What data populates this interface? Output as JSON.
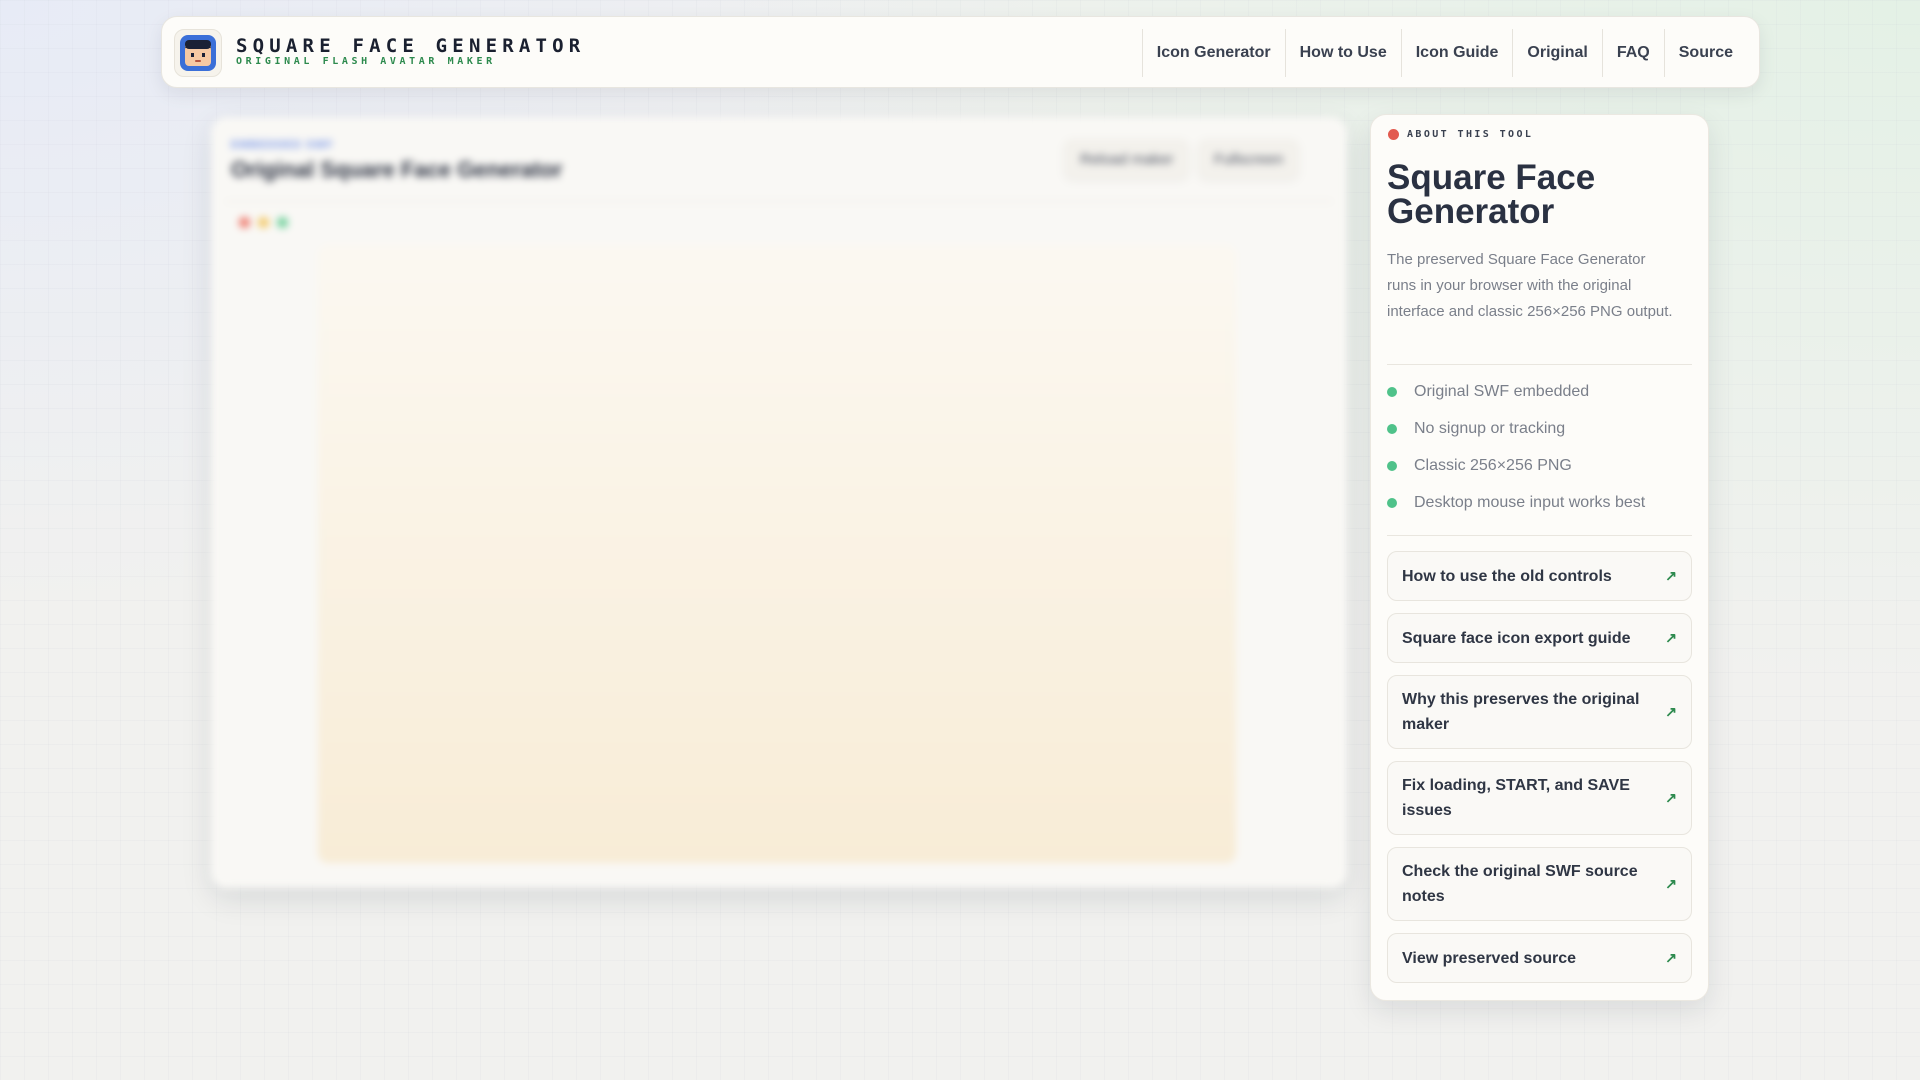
{
  "header": {
    "title": "SQUARE FACE GENERATOR",
    "subtitle": "ORIGINAL FLASH AVATAR MAKER",
    "logo_icon": "square-face-avatar-icon",
    "nav": [
      {
        "label": "Icon Generator"
      },
      {
        "label": "How to Use"
      },
      {
        "label": "Icon Guide"
      },
      {
        "label": "Original"
      },
      {
        "label": "FAQ"
      },
      {
        "label": "Source"
      }
    ]
  },
  "main": {
    "eyebrow": "EMBEDDED SWF",
    "title": "Original Square Face Generator",
    "reload_label": "Reload maker",
    "fullscreen_label": "Fullscreen"
  },
  "sidebar": {
    "eyebrow": "ABOUT THIS TOOL",
    "title": "Square Face Generator",
    "description": "The preserved Square Face Generator runs in your browser with the original interface and classic 256×256 PNG output.",
    "features": [
      "Original SWF embedded",
      "No signup or tracking",
      "Classic 256×256 PNG",
      "Desktop mouse input works best"
    ],
    "links": [
      {
        "label": "How to use the old controls"
      },
      {
        "label": "Square face icon export guide"
      },
      {
        "label": "Why this preserves the original maker"
      },
      {
        "label": "Fix loading, START, and SAVE issues"
      },
      {
        "label": "Check the original SWF source notes"
      },
      {
        "label": "View preserved source"
      }
    ]
  },
  "colors": {
    "accent_green": "#2d8a4e",
    "feature_dot": "#4fc28a",
    "eyebrow_dot": "#e25a4f",
    "logo_blue": "#3b6fd8"
  }
}
